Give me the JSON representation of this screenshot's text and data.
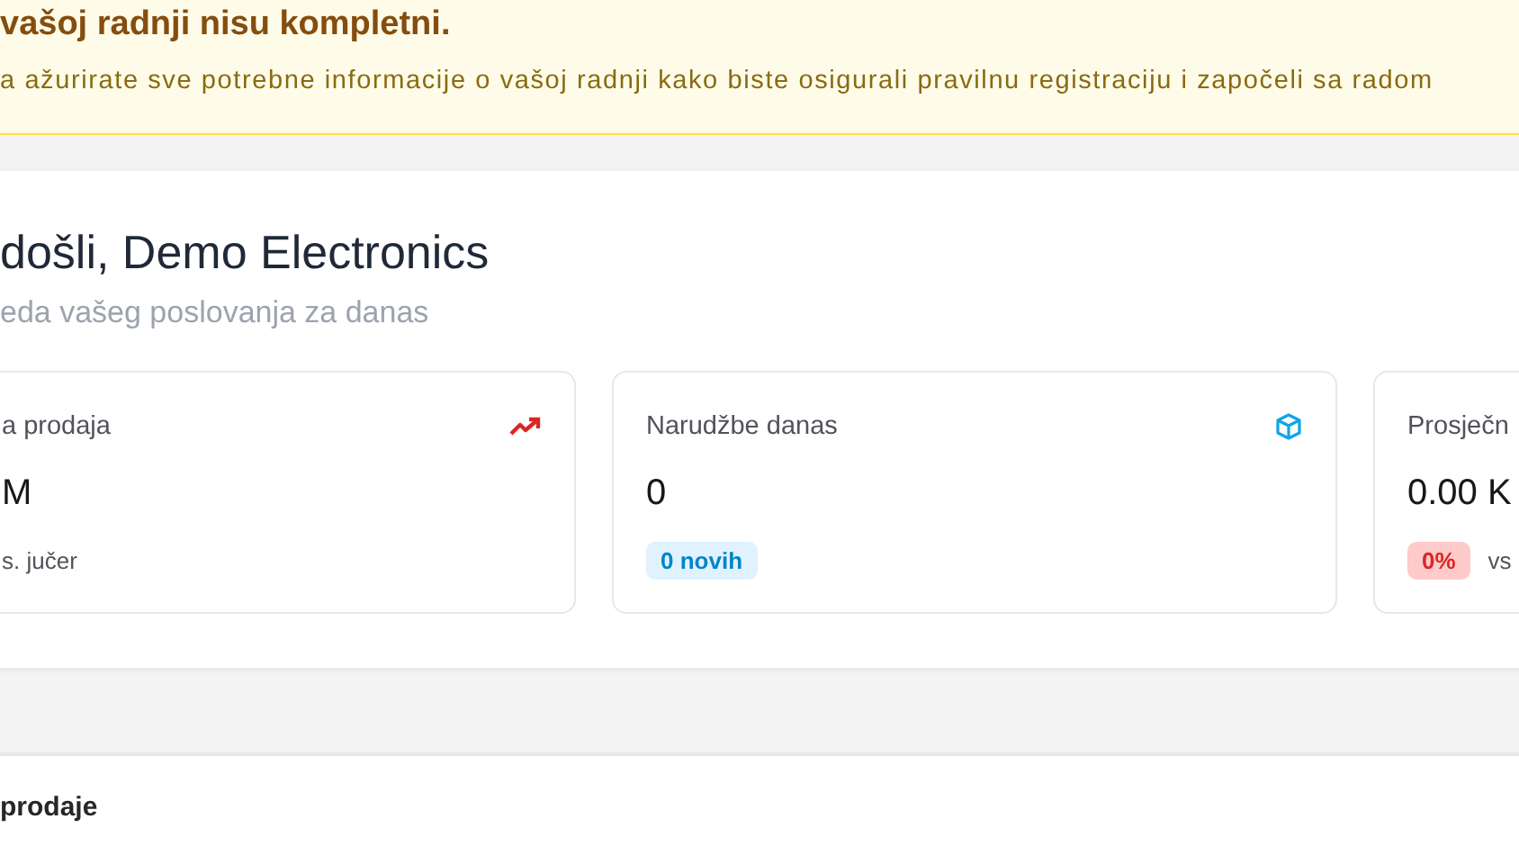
{
  "banner": {
    "title": "vašoj radnji nisu kompletni.",
    "message": "a ažurirate sve potrebne informacije o vašoj radnji kako biste osigurali pravilnu registraciju i započeli sa radom"
  },
  "welcome": {
    "title": "došli, Demo Electronics",
    "subtitle": "eda vašeg poslovanja za danas"
  },
  "stats": [
    {
      "label": "a prodaja",
      "value": "M",
      "note": "s. jučer"
    },
    {
      "label": "Narudžbe danas",
      "value": "0",
      "badge": {
        "text": "0 novih",
        "kind": "info"
      }
    },
    {
      "label": "Prosječn",
      "value": "0.00 K",
      "badge": {
        "text": "0%",
        "kind": "danger"
      },
      "note": "vs"
    }
  ],
  "section": {
    "title": "prodaje"
  }
}
